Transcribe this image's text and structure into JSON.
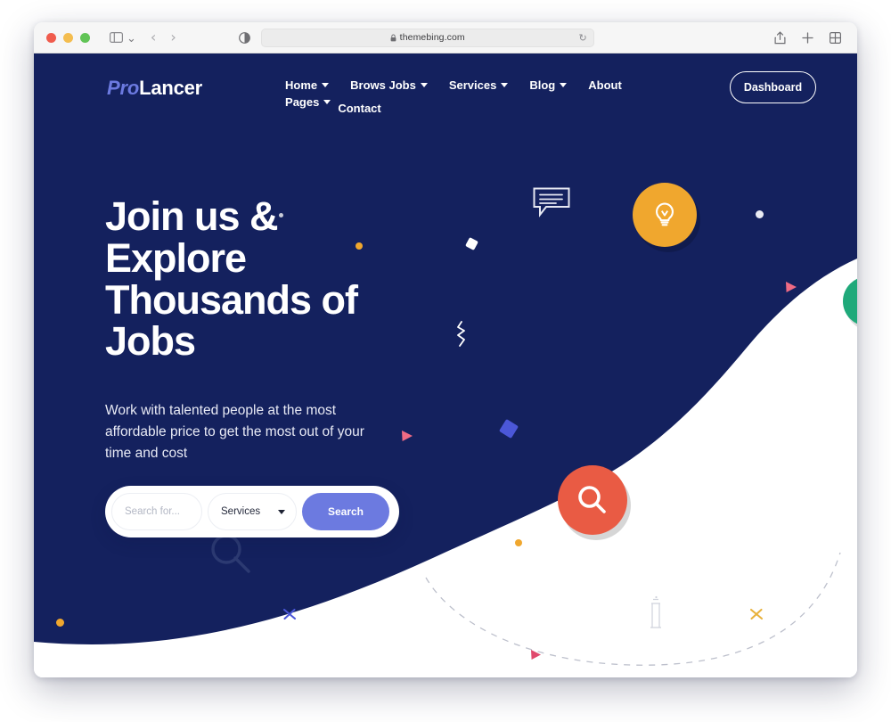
{
  "browser": {
    "url": "themebing.com",
    "lock_icon": "lock-icon",
    "reload_icon": "reload-icon",
    "sidebar_icon": "sidebar-toggle-icon",
    "tab_overview_icon": "tab-overview-icon",
    "share_icon": "share-icon",
    "new_tab_icon": "new-tab-icon",
    "reader_icon": "reader-view-icon",
    "back_arrow": "‹",
    "forward_arrow": "›",
    "chevron": "⌄",
    "traffic_lights": [
      {
        "name": "close",
        "color": "#f05c4d"
      },
      {
        "name": "minimize",
        "color": "#f4bd4f"
      },
      {
        "name": "zoom",
        "color": "#61c456"
      }
    ]
  },
  "site": {
    "logo": {
      "first": "Pro",
      "second": "Lancer"
    },
    "nav_items": [
      {
        "label": "Home",
        "has_caret": true
      },
      {
        "label": "Brows Jobs",
        "has_caret": true
      },
      {
        "label": "Services",
        "has_caret": true
      },
      {
        "label": "Blog",
        "has_caret": true
      },
      {
        "label": "About",
        "has_caret": false
      },
      {
        "label": "Pages",
        "has_caret": true
      },
      {
        "label": "Contact",
        "has_caret": false
      }
    ],
    "dashboard_label": "Dashboard"
  },
  "hero": {
    "title": "Join us &\nExplore\nThousands of\nJobs",
    "subtitle": "Work with talented people at the most\naffordable price to get the most out of your\ntime and cost"
  },
  "search": {
    "input_placeholder": "Search for...",
    "input_value": "",
    "category_value": "Services",
    "button_label": "Search"
  },
  "badges": [
    {
      "name": "idea-badge",
      "icon": "lightbulb-icon",
      "color": "#f0a72e"
    },
    {
      "name": "search-badge",
      "icon": "magnifier-icon",
      "color": "#e95b44"
    },
    {
      "name": "green-badge",
      "icon": "check-icon",
      "color": "#1fa97a"
    }
  ],
  "decorations": {
    "chat_bubble_icon": "chat-bubble-icon",
    "watermark_icon": "magnifier-watermark-icon",
    "pillar_icon": "pillar-icon",
    "colors": {
      "navy": "#14215e",
      "white": "#ffffff",
      "orange_dot": "#f0a72e",
      "pink_triangle": "#ef6b84",
      "blue_square": "#4b57d8",
      "periwinkle": "#6c7ae0",
      "yellow_cross": "#e8b23c",
      "grey_dot": "#c9ccd8"
    }
  }
}
